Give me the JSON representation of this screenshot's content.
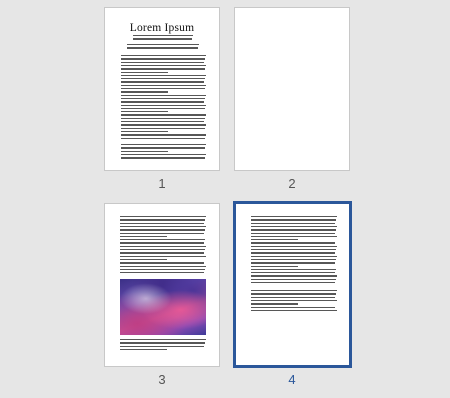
{
  "pages": [
    {
      "number": "1",
      "title": "Lorem Ipsum",
      "selected": false,
      "blank": false
    },
    {
      "number": "2",
      "selected": false,
      "blank": true
    },
    {
      "number": "3",
      "selected": false,
      "blank": false,
      "has_image": true
    },
    {
      "number": "4",
      "selected": true,
      "blank": false
    }
  ],
  "colors": {
    "selection": "#2b579a",
    "background": "#e6e6e6",
    "page": "#ffffff"
  }
}
